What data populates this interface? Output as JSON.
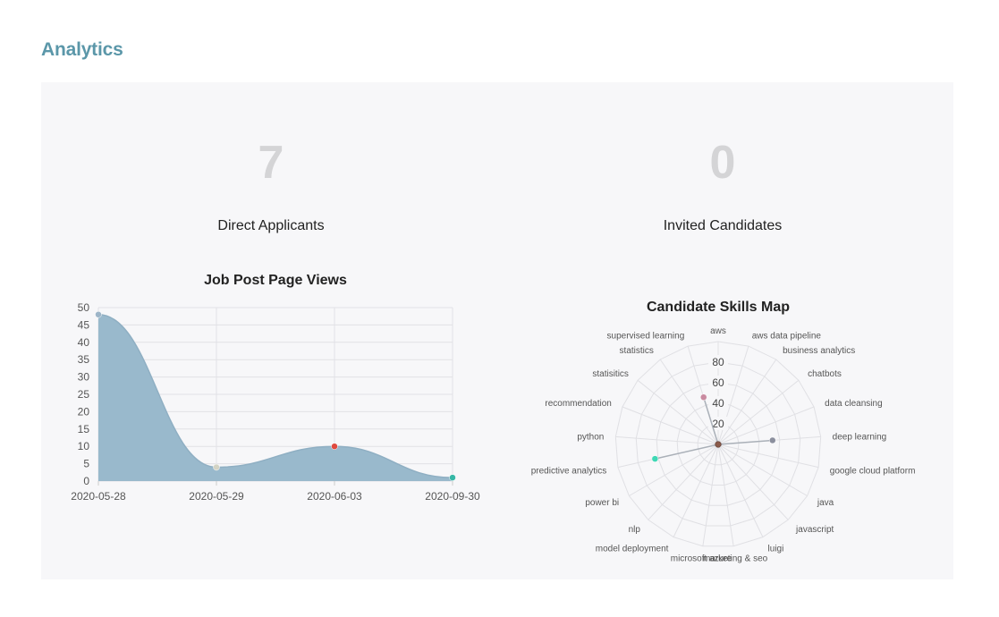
{
  "header": {
    "title": "Analytics"
  },
  "stats": [
    {
      "value": "7",
      "label": "Direct Applicants"
    },
    {
      "value": "0",
      "label": "Invited Candidates"
    }
  ],
  "chart_data": [
    {
      "type": "area",
      "title": "Job Post Page Views",
      "categories": [
        "2020-05-28",
        "2020-05-29",
        "2020-06-03",
        "2020-09-30"
      ],
      "values": [
        48,
        4,
        10,
        1
      ],
      "point_colors": [
        "#9db5c8",
        "#d3d3c4",
        "#e04a3f",
        "#36b7a6"
      ],
      "fill_color": "#99b9cc",
      "ylim": [
        0,
        50
      ],
      "yticks": [
        0,
        5,
        10,
        15,
        20,
        25,
        30,
        35,
        40,
        45,
        50
      ],
      "grid": true,
      "xlabel": "",
      "ylabel": ""
    },
    {
      "type": "radar",
      "title": "Candidate Skills Map",
      "rlim": [
        0,
        100
      ],
      "rticks": [
        20,
        40,
        60,
        80
      ],
      "axes": [
        "aws",
        "aws data pipeline",
        "business analytics",
        "chatbots",
        "data cleansing",
        "deep learning",
        "google cloud platform",
        "java",
        "javascript",
        "luigi",
        "marketing & seo",
        "microsoft azure",
        "model deployment",
        "nlp",
        "power bi",
        "predictive analytics",
        "python",
        "recommendation",
        "statisitics",
        "statistics",
        "supervised learning"
      ],
      "values": [
        0,
        0,
        0,
        0,
        0,
        53,
        0,
        0,
        0,
        0,
        0,
        0,
        0,
        0,
        0,
        63,
        0,
        0,
        0,
        0,
        48
      ],
      "point_colors": {
        "5": "#8b8f9e",
        "15": "#3ed8b5",
        "20": "#c98aa0"
      }
    }
  ]
}
